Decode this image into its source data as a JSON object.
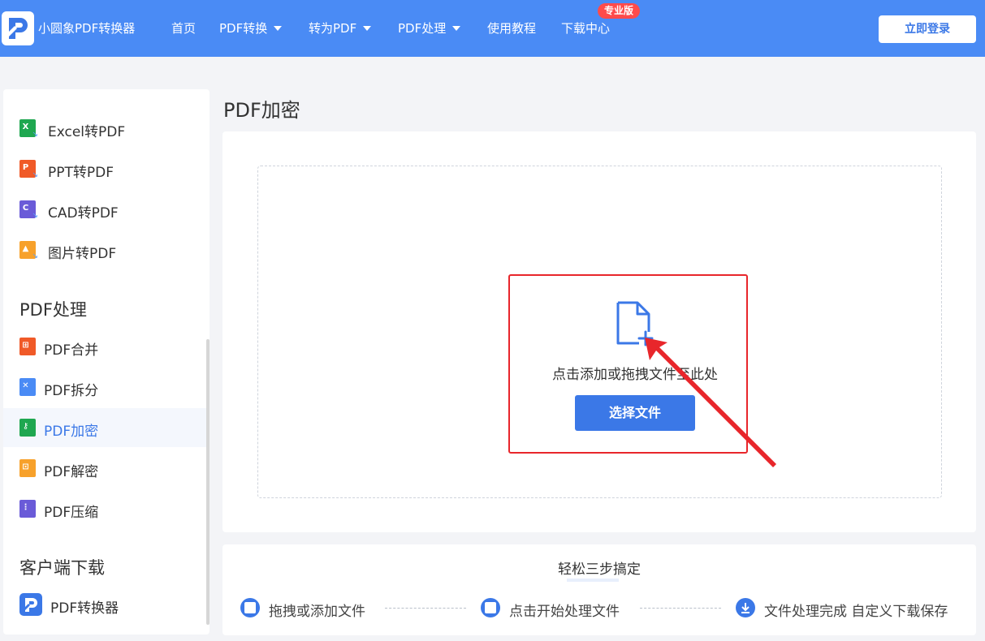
{
  "header": {
    "brand": "小圆象PDF转换器",
    "nav": [
      {
        "label": "首页",
        "has_caret": false
      },
      {
        "label": "PDF转换",
        "has_caret": true
      },
      {
        "label": "转为PDF",
        "has_caret": true
      },
      {
        "label": "PDF处理",
        "has_caret": true
      },
      {
        "label": "使用教程",
        "has_caret": false
      },
      {
        "label": "下载中心",
        "has_caret": false
      }
    ],
    "badge": "专业版",
    "login_label": "立即登录",
    "accent_color": "#4a8bf5"
  },
  "sidebar": {
    "convert_items": [
      {
        "label": "Excel转PDF",
        "icon": "excel-icon",
        "color": "#1fa750",
        "glyph": "X"
      },
      {
        "label": "PPT转PDF",
        "icon": "ppt-icon",
        "color": "#f05a28",
        "glyph": "P"
      },
      {
        "label": "CAD转PDF",
        "icon": "cad-icon",
        "color": "#6a5bd8",
        "glyph": "C"
      },
      {
        "label": "图片转PDF",
        "icon": "image-icon",
        "color": "#f7a12b",
        "glyph": "▲"
      }
    ],
    "process_heading": "PDF处理",
    "process_items": [
      {
        "label": "PDF合并",
        "icon": "merge-icon",
        "color": "#f05a28",
        "glyph": "⊞",
        "active": false
      },
      {
        "label": "PDF拆分",
        "icon": "split-icon",
        "color": "#4a8bf5",
        "glyph": "✕",
        "active": false
      },
      {
        "label": "PDF加密",
        "icon": "encrypt-icon",
        "color": "#1fa750",
        "glyph": "⚷",
        "active": true
      },
      {
        "label": "PDF解密",
        "icon": "decrypt-icon",
        "color": "#f7a12b",
        "glyph": "⊡",
        "active": false
      },
      {
        "label": "PDF压缩",
        "icon": "compress-icon",
        "color": "#6a5bd8",
        "glyph": "⋮",
        "active": false
      }
    ],
    "download_heading": "客户端下载",
    "download_item": {
      "label": "PDF转换器",
      "icon": "app-logo-icon"
    }
  },
  "main": {
    "title": "PDF加密",
    "drop_text": "点击添加或拖拽文件至此处",
    "select_label": "选择文件",
    "highlight_color": "#e8262b"
  },
  "steps": {
    "title": "轻松三步搞定",
    "items": [
      {
        "label": "拖拽或添加文件",
        "icon": "file-step-icon"
      },
      {
        "label": "点击开始处理文件",
        "icon": "process-step-icon"
      },
      {
        "label": "文件处理完成 自定义下载保存",
        "icon": "download-step-icon"
      }
    ]
  }
}
